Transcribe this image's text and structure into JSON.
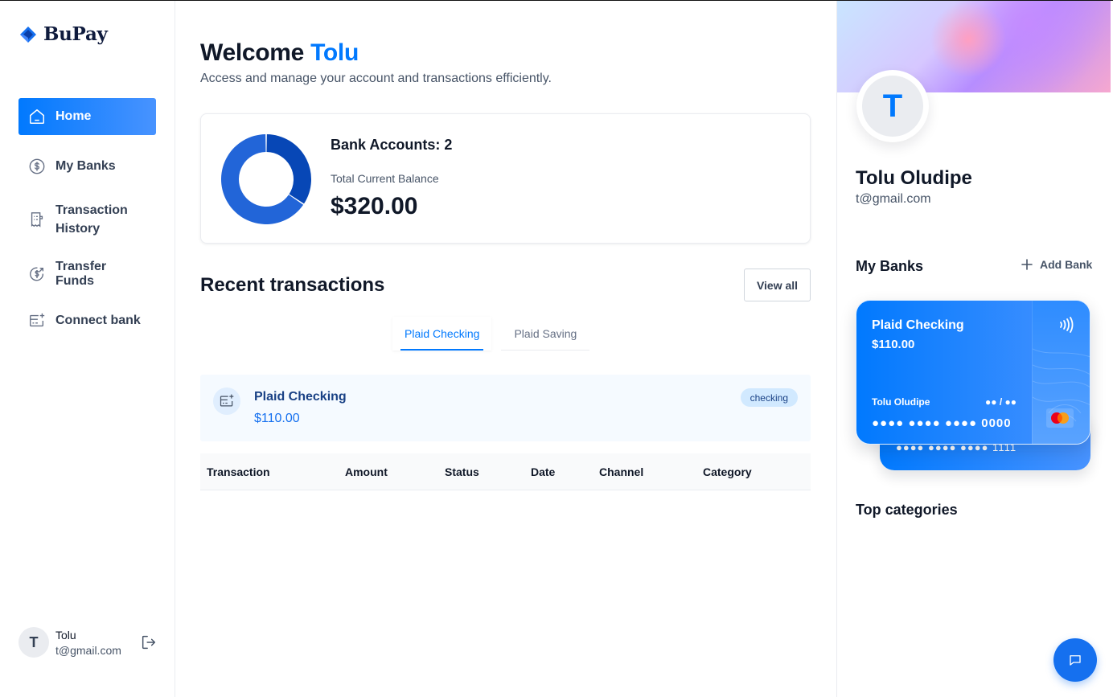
{
  "app": {
    "name": "BuPay"
  },
  "sidebar": {
    "items": [
      {
        "label": "Home",
        "icon": "home-icon",
        "active": true
      },
      {
        "label": "My Banks",
        "icon": "dollar-circle-icon",
        "active": false
      },
      {
        "label": "Transaction History",
        "icon": "receipt-icon",
        "active": false
      },
      {
        "label": "Transfer Funds",
        "icon": "money-send-icon",
        "active": false
      },
      {
        "label": "Connect bank",
        "icon": "card-add-icon",
        "active": false
      }
    ],
    "user": {
      "initial": "T",
      "name": "Tolu",
      "email": "t@gmail.com"
    }
  },
  "header": {
    "welcome_prefix": "Welcome",
    "welcome_name": "Tolu",
    "subtitle": "Access and manage your account and transactions efficiently."
  },
  "balance": {
    "bank_accounts_label": "Bank Accounts: 2",
    "total_label": "Total Current Balance",
    "total_value": "$320.00",
    "donut_segments": [
      {
        "value": 110,
        "color": "#0747b6"
      },
      {
        "value": 210,
        "color": "#2265d8"
      }
    ]
  },
  "recent": {
    "title": "Recent transactions",
    "view_all": "View all",
    "tabs": [
      {
        "label": "Plaid Checking",
        "active": true
      },
      {
        "label": "Plaid Saving",
        "active": false
      }
    ],
    "bank_info": {
      "name": "Plaid Checking",
      "amount": "$110.00",
      "badge": "checking"
    },
    "columns": [
      "Transaction",
      "Amount",
      "Status",
      "Date",
      "Channel",
      "Category"
    ]
  },
  "profile": {
    "initial": "T",
    "name": "Tolu Oludipe",
    "email": "t@gmail.com"
  },
  "my_banks": {
    "title": "My Banks",
    "add_label": "Add Bank",
    "card": {
      "name": "Plaid Checking",
      "balance": "$110.00",
      "holder": "Tolu Oludipe",
      "expiry": "●● / ●●",
      "number": "●●●● ●●●● ●●●● 0000"
    },
    "back_card_number": "●●●● ●●●● ●●●● 1111"
  },
  "top_categories": {
    "title": "Top categories"
  },
  "colors": {
    "accent": "#0179fe",
    "bankinfo_bg": "#f5faff"
  }
}
